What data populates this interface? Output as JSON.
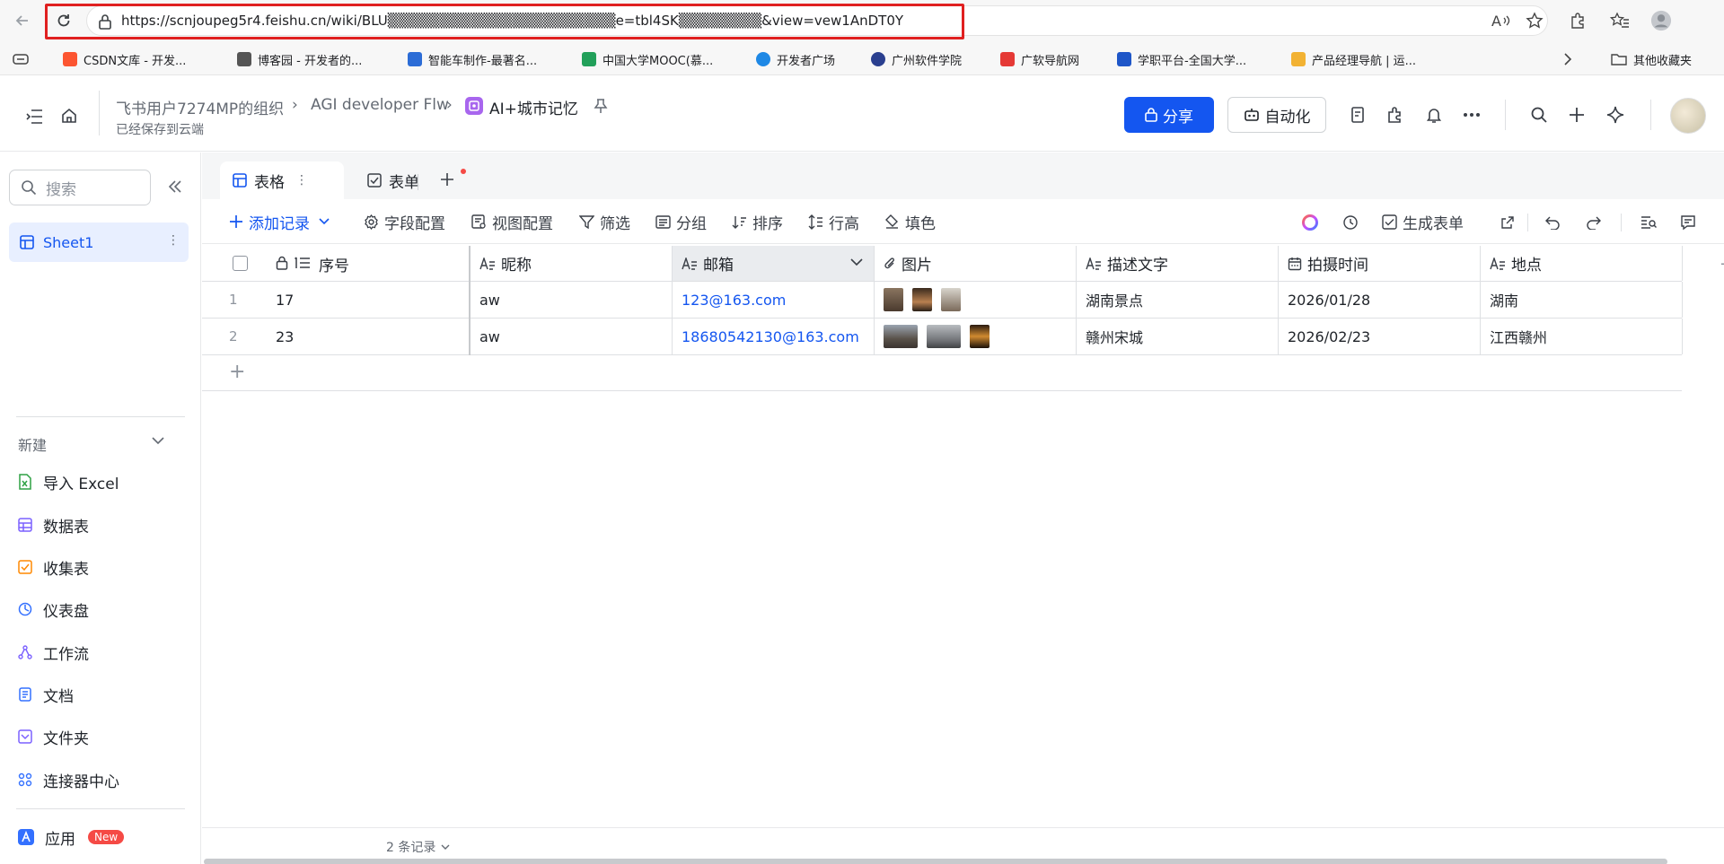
{
  "browser": {
    "url": "https://scnjoupeg5r4.feishu.cn/wiki/BLU▒▒▒▒▒▒▒▒▒▒▒▒▒▒▒▒▒▒▒▒▒▒e=tbl4SK▒▒▒▒▒▒▒▒&view=vew1AnDT0Y",
    "bookmarks": [
      {
        "label": "CSDN文库 - 开发...",
        "color": "#fc5531"
      },
      {
        "label": "博客园 - 开发者的...",
        "color": "#555555"
      },
      {
        "label": "智能车制作-最著名...",
        "color": "#2b6cd6"
      },
      {
        "label": "中国大学MOOC(慕...",
        "color": "#22a05a"
      },
      {
        "label": "开发者广场",
        "color": "#1e88e5"
      },
      {
        "label": "广州软件学院",
        "color": "#2a3f8f"
      },
      {
        "label": "广软导航网",
        "color": "#e53935"
      },
      {
        "label": "学职平台-全国大学...",
        "color": "#1e56c8"
      },
      {
        "label": "产品经理导航 | 运...",
        "color": "#f2b233"
      }
    ],
    "other_bookmarks": "其他收藏夹"
  },
  "header": {
    "breadcrumb": [
      "飞书用户7274MP的组织",
      "AGI developer Flw",
      "AI+城市记忆"
    ],
    "saved_status": "已经保存到云端",
    "share_label": "分享",
    "automation_label": "自动化"
  },
  "sidebar": {
    "search_placeholder": "搜索",
    "sheet_name": "Sheet1",
    "new_label": "新建",
    "items": [
      {
        "label": "导入 Excel",
        "icon": "excel-icon",
        "color": "#2ea043"
      },
      {
        "label": "数据表",
        "icon": "table-icon",
        "color": "#7b61ff"
      },
      {
        "label": "收集表",
        "icon": "form-icon",
        "color": "#ff8800"
      },
      {
        "label": "仪表盘",
        "icon": "dashboard-icon",
        "color": "#3370ff"
      },
      {
        "label": "工作流",
        "icon": "workflow-icon",
        "color": "#7b61ff"
      },
      {
        "label": "文档",
        "icon": "doc-icon",
        "color": "#3370ff"
      },
      {
        "label": "文件夹",
        "icon": "folder-icon",
        "color": "#7b61ff"
      },
      {
        "label": "连接器中心",
        "icon": "connector-icon",
        "color": "#3370ff"
      }
    ],
    "app_label": "应用",
    "app_badge": "New"
  },
  "tabs": {
    "grid_tab": "表格",
    "form_tab": "表单"
  },
  "toolbar": {
    "add_record": "添加记录",
    "field_config": "字段配置",
    "view_config": "视图配置",
    "filter": "筛选",
    "group": "分组",
    "sort": "排序",
    "row_height": "行高",
    "fill_color": "填色",
    "generate_form": "生成表单"
  },
  "table": {
    "columns": [
      "序号",
      "昵称",
      "邮箱",
      "图片",
      "描述文字",
      "拍摄时间",
      "地点"
    ],
    "rows": [
      {
        "num": "1",
        "seq": "17",
        "nickname": "aw",
        "email": "123@163.com",
        "images": 3,
        "desc": "湖南景点",
        "time": "2026/01/28",
        "place": "湖南"
      },
      {
        "num": "2",
        "seq": "23",
        "nickname": "aw",
        "email": "18680542130@163.com",
        "images": 3,
        "desc": "赣州宋城",
        "time": "2026/02/23",
        "place": "江西赣州"
      }
    ],
    "record_count": "2 条记录"
  }
}
